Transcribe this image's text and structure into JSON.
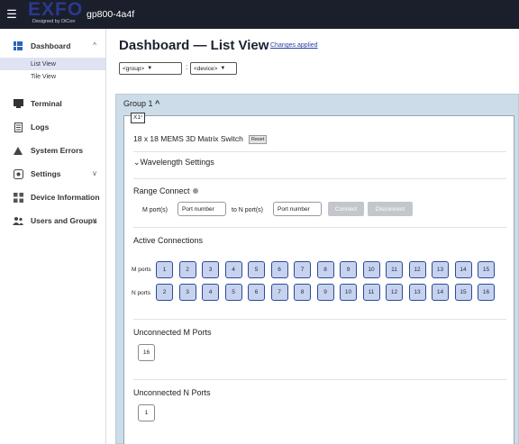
{
  "topbar": {
    "logo_text": "EXFO",
    "logo_tagline": "Designed by DiCon",
    "device_name": "gp800-4a4f"
  },
  "sidebar": {
    "items": [
      {
        "label": "Dashboard",
        "icon": "dashboard-icon",
        "expandable": true,
        "expanded": true,
        "children": [
          {
            "label": "List View",
            "active": true
          },
          {
            "label": "Tile View",
            "active": false
          }
        ]
      },
      {
        "label": "Terminal",
        "icon": "terminal-icon"
      },
      {
        "label": "Logs",
        "icon": "logs-icon"
      },
      {
        "label": "System Errors",
        "icon": "warning-icon"
      },
      {
        "label": "Settings",
        "icon": "settings-icon",
        "expandable": true
      },
      {
        "label": "Device Information",
        "icon": "device-info-icon"
      },
      {
        "label": "Users and Groups",
        "icon": "users-icon",
        "expandable": true
      }
    ]
  },
  "main": {
    "title": "Dashboard — List View",
    "changes_link": "Changes applied",
    "group_select": "<group>",
    "device_select": "<device>",
    "group_title": "Group 1",
    "switch_tag": "X1",
    "switch_title": "18 x 18 MEMS 3D Matrix Switch",
    "reset_label": "Reset",
    "wavelength_label": "Wavelength Settings",
    "range_connect": {
      "title": "Range Connect",
      "m_label": "M port(s)",
      "n_label": "to N port(s)",
      "m_placeholder": "Port number",
      "n_placeholder": "Port number",
      "connect_label": "Connect",
      "disconnect_label": "Disconnect"
    },
    "active_connections": {
      "title": "Active Connections",
      "m_label": "M ports",
      "n_label": "N ports",
      "m_ports": [
        "1",
        "2",
        "3",
        "4",
        "5",
        "6",
        "7",
        "8",
        "9",
        "10",
        "11",
        "12",
        "13",
        "14",
        "15"
      ],
      "n_ports": [
        "2",
        "3",
        "4",
        "5",
        "6",
        "7",
        "8",
        "9",
        "10",
        "11",
        "12",
        "13",
        "14",
        "15",
        "16"
      ]
    },
    "unconnected_m": {
      "title": "Unconnected M Ports",
      "ports": [
        "16"
      ]
    },
    "unconnected_n": {
      "title": "Unconnected N Ports",
      "ports": [
        "1"
      ]
    }
  },
  "colors": {
    "topbar_bg": "#1b1f2b",
    "accent_blue": "#2c4a9c",
    "port_fill": "#c7d3ed",
    "group_bg": "#ccdde9",
    "active_nav_bg": "#dfe3f3"
  }
}
